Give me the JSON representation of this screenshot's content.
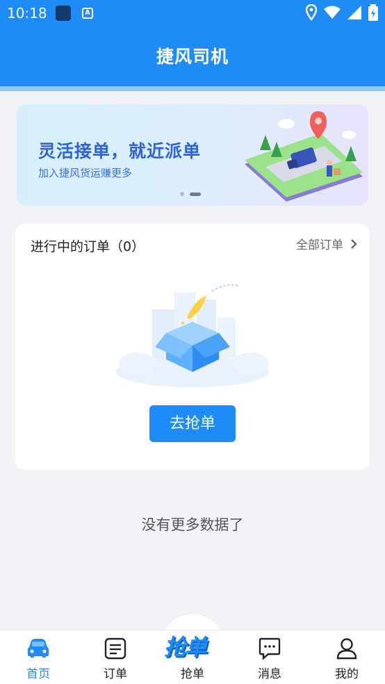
{
  "status_bar": {
    "time": "10:18",
    "notif_icon": "A"
  },
  "app_bar": {
    "title": "捷风司机"
  },
  "banner": {
    "headline": "灵活接单，就近派单",
    "subtitle": "加入捷风货运赚更多",
    "dots": 2,
    "active_dot": 1
  },
  "orders": {
    "title": "进行中的订单（0）",
    "all_link": "全部订单",
    "action_button": "去抢单"
  },
  "footer_note": "没有更多数据了",
  "tabbar": {
    "items": [
      {
        "label": "首页",
        "icon": "car-icon",
        "active": true
      },
      {
        "label": "订单",
        "icon": "order-list-icon",
        "active": false
      },
      {
        "label": "抢单",
        "icon": "grab-order-logo",
        "active": false
      },
      {
        "label": "消息",
        "icon": "message-icon",
        "active": false
      },
      {
        "label": "我的",
        "icon": "profile-icon",
        "active": false
      }
    ],
    "center_logo_text": "抢单"
  },
  "colors": {
    "primary": "#1e8bf7",
    "background": "#f2f3f7",
    "headline": "#2c63e6"
  }
}
